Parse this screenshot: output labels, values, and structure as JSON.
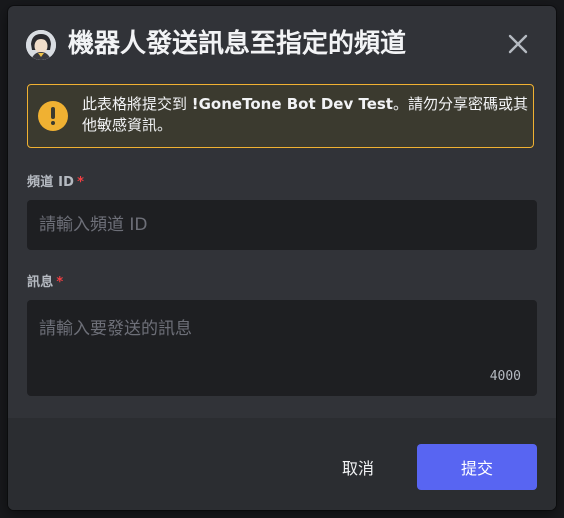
{
  "modal": {
    "title": "機器人發送訊息至指定的頻道",
    "avatar_icon": "bot-avatar"
  },
  "warning": {
    "prefix": "此表格將提交到 ",
    "bot_name": "!GoneTone Bot Dev Test",
    "suffix": "。請勿分享密碼或其他敏感資訊。",
    "accent": "#f0b132"
  },
  "fields": {
    "channel": {
      "label": "頻道 ID",
      "required_mark": "*",
      "placeholder": "請輸入頻道 ID",
      "value": ""
    },
    "message": {
      "label": "訊息",
      "required_mark": "*",
      "placeholder": "請輸入要發送的訊息",
      "value": "",
      "char_limit": "4000"
    }
  },
  "footer": {
    "cancel_label": "取消",
    "submit_label": "提交",
    "submit_color": "#5865f2"
  }
}
